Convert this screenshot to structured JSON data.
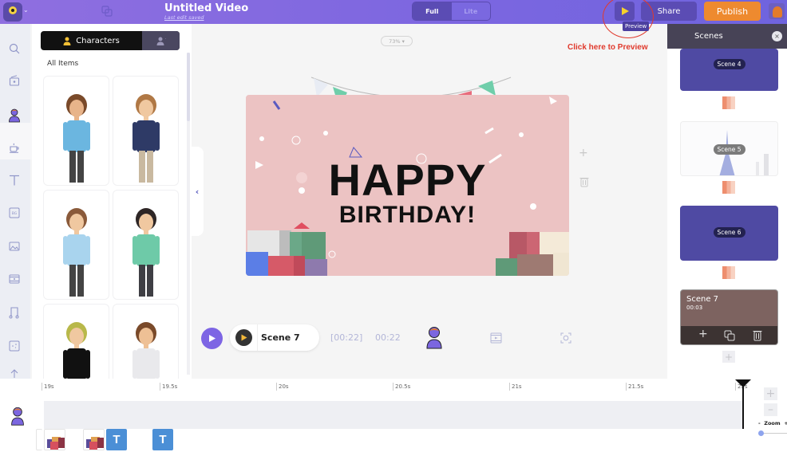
{
  "header": {
    "title": "Untitled Video",
    "subtitle": "Last edit saved",
    "mode_toggle": {
      "options": [
        "Full",
        "Lite"
      ],
      "selected": "Full"
    },
    "preview_tooltip": "Preview",
    "share_label": "Share",
    "publish_label": "Publish",
    "accent_color": "#7b66e0",
    "publish_color": "#ee8a2f"
  },
  "annotation": {
    "text": "Click here to Preview",
    "color": "#e03a2d"
  },
  "sidebar": {
    "items": [
      {
        "icon": "search-icon"
      },
      {
        "icon": "media-icon"
      },
      {
        "icon": "character-icon",
        "active": true
      },
      {
        "icon": "coffee-cup-icon"
      },
      {
        "icon": "text-icon"
      },
      {
        "icon": "background-icon",
        "label": "BG"
      },
      {
        "icon": "image-icon"
      },
      {
        "icon": "video-icon"
      },
      {
        "icon": "music-icon"
      },
      {
        "icon": "effects-icon"
      },
      {
        "icon": "upload-icon"
      }
    ]
  },
  "library": {
    "tab_characters": "Characters",
    "section_title": "All Items",
    "items": [
      {
        "name": "Woman with glasses, blue blazer"
      },
      {
        "name": "Curly-haired man, navy hoodie"
      },
      {
        "name": "Man with tie, light blue shirt"
      },
      {
        "name": "Woman, green blouse"
      },
      {
        "name": "Blond man, black tuxedo"
      },
      {
        "name": "Woman, white halter top"
      }
    ]
  },
  "canvas": {
    "zoom": "73%",
    "line1": "HAPPY",
    "line2": "BIRTHDAY!"
  },
  "scene_bar": {
    "scene_name": "Scene 7",
    "total_time": "[00:22]",
    "current_time": "00:22"
  },
  "scenes_panel": {
    "title": "Scenes",
    "scenes": [
      {
        "label": "Scene 4"
      },
      {
        "label": "Scene 5"
      },
      {
        "label": "Scene 6"
      },
      {
        "label": "Scene 7",
        "duration": "00:03",
        "selected": true
      }
    ]
  },
  "timeline": {
    "ticks": [
      "19s",
      "19.5s",
      "20s",
      "20.5s",
      "21s",
      "21.5s",
      "22s"
    ],
    "zoom_label": "Zoom",
    "zoom_minus": "-",
    "zoom_plus": "+",
    "text_layer_label": "T"
  }
}
